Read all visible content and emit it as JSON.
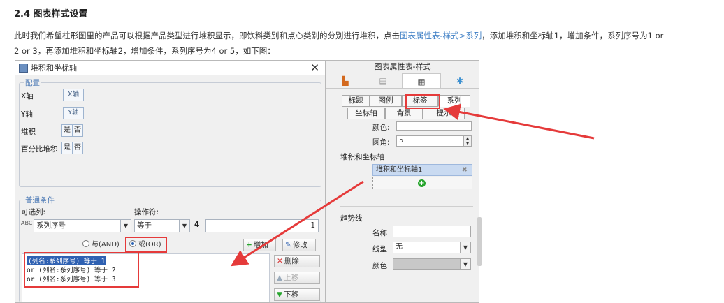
{
  "article": {
    "heading": "2.4 图表样式设置",
    "para_line1_pre": "此时我们希望柱形图里的产品可以根据产品类型进行堆积显示，即饮料类别和点心类别的分别进行堆积，点击",
    "para_link": "图表属性表-样式>系列",
    "para_line1_post": "，添加堆积和坐标轴1，增加条件，系列序号为1 or",
    "para_line2": "2 or 3，再添加堆积和坐标轴2，增加条件，系列序号为4 or 5，如下图："
  },
  "dialog": {
    "title": "堆积和坐标轴",
    "close": "✕",
    "config_group": "配置",
    "x_axis_label": "X轴",
    "x_axis_btn": "X轴",
    "y_axis_label": "Y轴",
    "y_axis_btn": "Y轴",
    "stack_label": "堆积",
    "pct_stack_label": "百分比堆积",
    "yes": "是",
    "no": "否",
    "condition_group": "普通条件",
    "optional_col_label": "可选列:",
    "operator_label": "操作符:",
    "column_value": "系列序号",
    "operator_value": "等于",
    "num_prefix": "4",
    "value_input": "1",
    "radio_and": "与(AND)",
    "radio_or": "或(OR)",
    "add_btn": "增加",
    "edit_btn": "修改",
    "delete_btn": "删除",
    "up_btn": "上移",
    "down_btn": "下移",
    "conditions": [
      "(列名:系列序号) 等于 1",
      "or  (列名:系列序号) 等于 2",
      "or  (列名:系列序号) 等于 3"
    ]
  },
  "panel": {
    "title": "图表属性表-样式",
    "tabs_row1": [
      "标题",
      "图例",
      "标签",
      "系列"
    ],
    "tabs_row2": [
      "坐标轴",
      "背景",
      "提示"
    ],
    "color_label": "颜色:",
    "radius_label": "圆角:",
    "radius_value": "5",
    "stack_section": "堆积和坐标轴",
    "stack_item": "堆积和坐标轴1",
    "trend_section": "趋势线",
    "name_label": "名称",
    "linetype_label": "线型",
    "linetype_value": "无",
    "color2_label": "颜色"
  },
  "colors": {
    "link": "#3a7cc4",
    "highlight": "#e53a3a",
    "selected_row": "#2f61b2"
  }
}
